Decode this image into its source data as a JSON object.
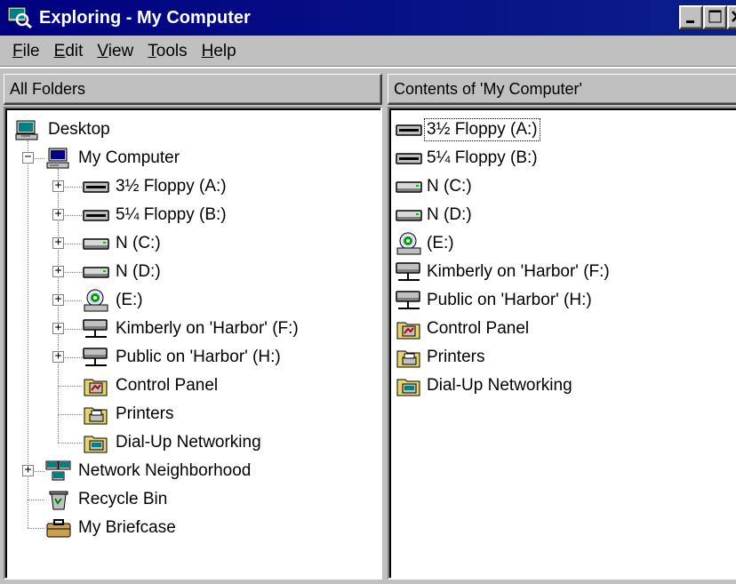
{
  "window": {
    "title": "Exploring - My Computer"
  },
  "menu": [
    {
      "accel": "F",
      "rest": "ile"
    },
    {
      "accel": "E",
      "rest": "dit"
    },
    {
      "accel": "V",
      "rest": "iew"
    },
    {
      "accel": "T",
      "rest": "ools"
    },
    {
      "accel": "H",
      "rest": "elp"
    }
  ],
  "left_pane": {
    "header": "All Folders",
    "tree": [
      {
        "label": "Desktop",
        "icon": "desktop-icon"
      },
      {
        "label": "My Computer",
        "icon": "computer-icon",
        "expander": "−"
      },
      {
        "label": "3½ Floppy (A:)",
        "icon": "floppy-drive-icon",
        "expander": "+"
      },
      {
        "label": "5¼ Floppy (B:)",
        "icon": "floppy-drive-icon",
        "expander": "+"
      },
      {
        "label": "N (C:)",
        "icon": "hard-drive-icon",
        "expander": "+"
      },
      {
        "label": "N (D:)",
        "icon": "hard-drive-icon",
        "expander": "+"
      },
      {
        "label": "(E:)",
        "icon": "cd-drive-icon",
        "expander": "+"
      },
      {
        "label": "Kimberly on 'Harbor' (F:)",
        "icon": "network-drive-icon",
        "expander": "+"
      },
      {
        "label": "Public on 'Harbor' (H:)",
        "icon": "network-drive-icon",
        "expander": "+"
      },
      {
        "label": "Control Panel",
        "icon": "control-panel-folder-icon"
      },
      {
        "label": "Printers",
        "icon": "printers-folder-icon"
      },
      {
        "label": "Dial-Up Networking",
        "icon": "dialup-folder-icon"
      },
      {
        "label": "Network Neighborhood",
        "icon": "network-neighborhood-icon",
        "expander": "+"
      },
      {
        "label": "Recycle Bin",
        "icon": "recycle-bin-icon"
      },
      {
        "label": "My Briefcase",
        "icon": "briefcase-icon"
      }
    ]
  },
  "right_pane": {
    "header": "Contents of 'My Computer'",
    "items": [
      {
        "label": "3½ Floppy (A:)",
        "icon": "floppy-drive-icon"
      },
      {
        "label": "5¼ Floppy (B:)",
        "icon": "floppy-drive-icon"
      },
      {
        "label": "N (C:)",
        "icon": "hard-drive-icon"
      },
      {
        "label": "N (D:)",
        "icon": "hard-drive-icon"
      },
      {
        "label": "(E:)",
        "icon": "cd-drive-icon"
      },
      {
        "label": "Kimberly on 'Harbor' (F:)",
        "icon": "network-drive-icon"
      },
      {
        "label": "Public on 'Harbor' (H:)",
        "icon": "network-drive-icon"
      },
      {
        "label": "Control Panel",
        "icon": "control-panel-folder-icon"
      },
      {
        "label": "Printers",
        "icon": "printers-folder-icon"
      },
      {
        "label": "Dial-Up Networking",
        "icon": "dialup-folder-icon"
      }
    ]
  },
  "colors": {
    "title_bar": "#000080",
    "face": "#c0c0c0",
    "window": "#ffffff"
  }
}
